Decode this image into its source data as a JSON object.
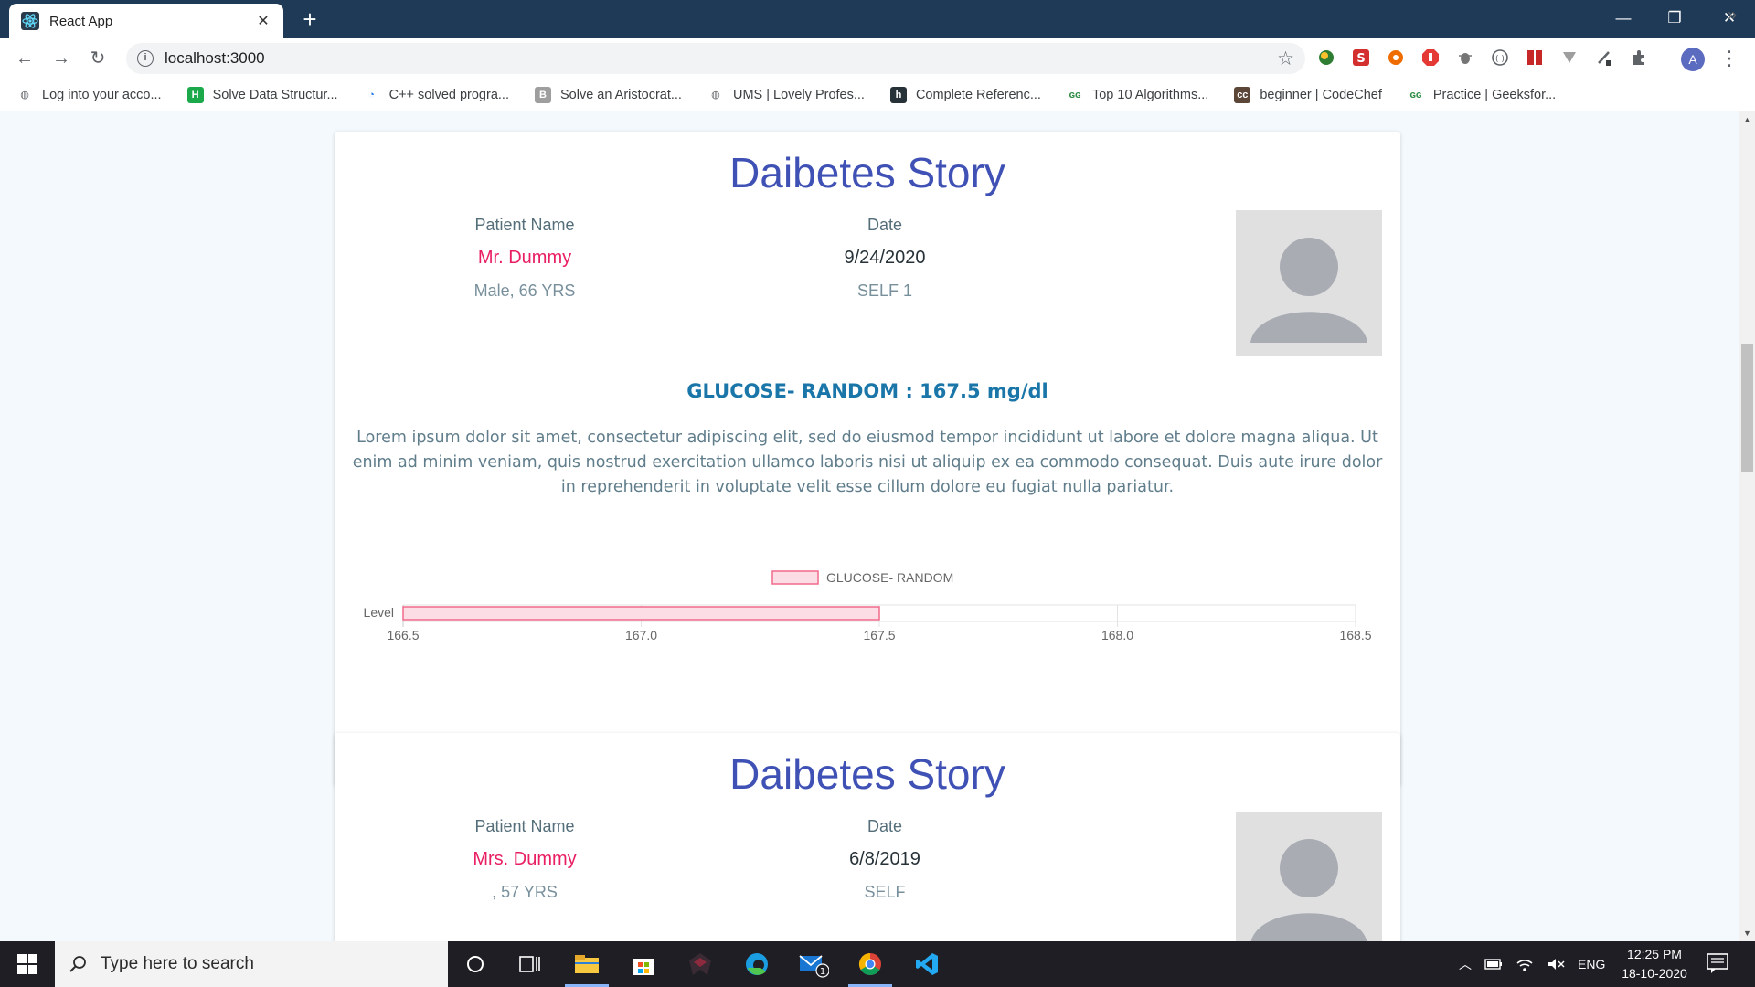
{
  "browser": {
    "tab_title": "React App",
    "url": "localhost:3000",
    "profile_initial": "A",
    "bookmarks": [
      {
        "label": "Log into your acco...",
        "icon": "globe-icon"
      },
      {
        "label": "Solve Data Structur...",
        "icon": "hackerrank-icon"
      },
      {
        "label": "C++ solved progra...",
        "icon": "site-icon"
      },
      {
        "label": "Solve an Aristocrat...",
        "icon": "b-icon"
      },
      {
        "label": "UMS | Lovely Profes...",
        "icon": "globe-icon"
      },
      {
        "label": "Complete Referenc...",
        "icon": "h-icon"
      },
      {
        "label": "Top 10 Algorithms...",
        "icon": "gfg-icon"
      },
      {
        "label": "beginner | CodeChef",
        "icon": "codechef-icon"
      },
      {
        "label": "Practice | Geeksfor...",
        "icon": "gfg-icon"
      }
    ]
  },
  "cards": [
    {
      "title": "Daibetes Story",
      "patient_label": "Patient Name",
      "patient_name": "Mr. Dummy",
      "patient_info": "Male, 66 YRS",
      "date_label": "Date",
      "date": "9/24/2020",
      "relation": "SELF 1",
      "reading": "GLUCOSE- RANDOM : 167.5 mg/dl",
      "description": "Lorem ipsum dolor sit amet, consectetur adipiscing elit, sed do eiusmod tempor incididunt ut labore et dolore magna aliqua. Ut enim ad minim veniam, quis nostrud exercitation ullamco laboris nisi ut aliquip ex ea commodo consequat. Duis aute irure dolor in reprehenderit in voluptate velit esse cillum dolore eu fugiat nulla pariatur."
    },
    {
      "title": "Daibetes Story",
      "patient_label": "Patient Name",
      "patient_name": "Mrs. Dummy",
      "patient_info": ", 57 YRS",
      "date_label": "Date",
      "date": "6/8/2019",
      "relation": "SELF"
    }
  ],
  "chart_data": {
    "type": "bar",
    "orientation": "horizontal",
    "categories": [
      "Level"
    ],
    "series": [
      {
        "name": "GLUCOSE- RANDOM",
        "values": [
          167.5
        ]
      }
    ],
    "xlim": [
      166.5,
      168.5
    ],
    "xticks": [
      "166.5",
      "167.0",
      "167.5",
      "168.0",
      "168.5"
    ],
    "legend": "top",
    "grid": true,
    "bar_fill": "#fcdde5",
    "bar_stroke": "#f06a8a"
  },
  "taskbar": {
    "search_placeholder": "Type here to search",
    "language": "ENG",
    "time": "12:25 PM",
    "date": "18-10-2020",
    "mail_badge": "1"
  },
  "colors": {
    "title": "#3f51b5",
    "patient_name": "#e91e63",
    "reading": "#1a76a8"
  }
}
